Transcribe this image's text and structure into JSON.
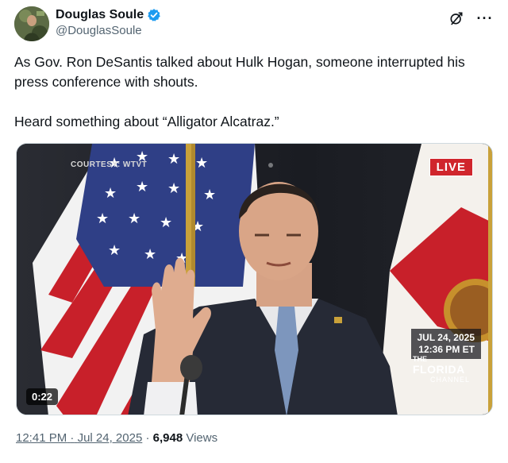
{
  "author": {
    "display_name": "Douglas Soule",
    "handle": "@DouglasSoule",
    "verified": true
  },
  "tweet": {
    "paragraphs": [
      "As Gov. Ron DeSantis talked about Hulk Hogan, someone interrupted his press conference with shouts.",
      "Heard something about “Alligator Alcatraz.”"
    ]
  },
  "video": {
    "courtesy": "COURTESY: WTVT",
    "live_label": "LIVE",
    "stamp_date": "JUL 24, 2025",
    "stamp_time": "12:36 PM ET",
    "channel_the": "THE",
    "channel_name": "FLORIDA",
    "channel_word": "CHANNEL",
    "duration": "0:22"
  },
  "meta": {
    "time": "12:41 PM",
    "separator": "·",
    "date": "Jul 24, 2025",
    "views_count": "6,948",
    "views_label": "Views"
  },
  "icons": {
    "verified": "verified-badge-icon",
    "grok": "grok-icon",
    "more": "more-options-icon"
  },
  "colors": {
    "verified_blue": "#1d9bf0",
    "live_red": "#d0262d",
    "muted_text": "#536471"
  }
}
